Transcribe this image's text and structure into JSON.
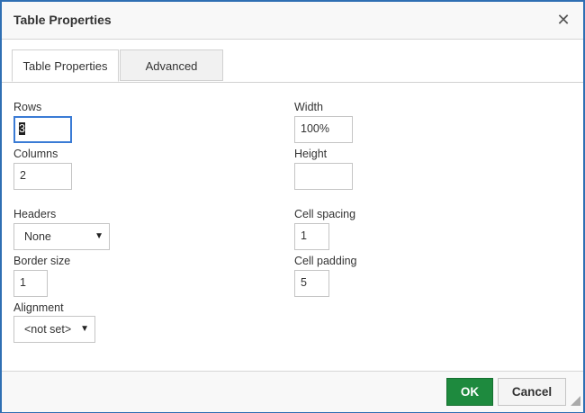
{
  "dialog": {
    "title": "Table Properties",
    "close_glyph": "✕"
  },
  "tabs": [
    {
      "label": "Table Properties",
      "active": true
    },
    {
      "label": "Advanced",
      "active": false
    }
  ],
  "form": {
    "rows": {
      "label": "Rows",
      "value": "3"
    },
    "columns": {
      "label": "Columns",
      "value": "2"
    },
    "headers": {
      "label": "Headers",
      "value": "None"
    },
    "border_size": {
      "label": "Border size",
      "value": "1"
    },
    "alignment": {
      "label": "Alignment",
      "value": "<not set>"
    },
    "width": {
      "label": "Width",
      "value": "100%"
    },
    "height": {
      "label": "Height",
      "value": ""
    },
    "cell_spacing": {
      "label": "Cell spacing",
      "value": "1"
    },
    "cell_padding": {
      "label": "Cell padding",
      "value": "5"
    }
  },
  "footer": {
    "ok_label": "OK",
    "cancel_label": "Cancel"
  },
  "icons": {
    "dropdown_arrow": "▼"
  },
  "colors": {
    "ok_button": "#1e8a3e",
    "focus_border": "#3a7bd5",
    "window_border": "#2f6fb3"
  }
}
